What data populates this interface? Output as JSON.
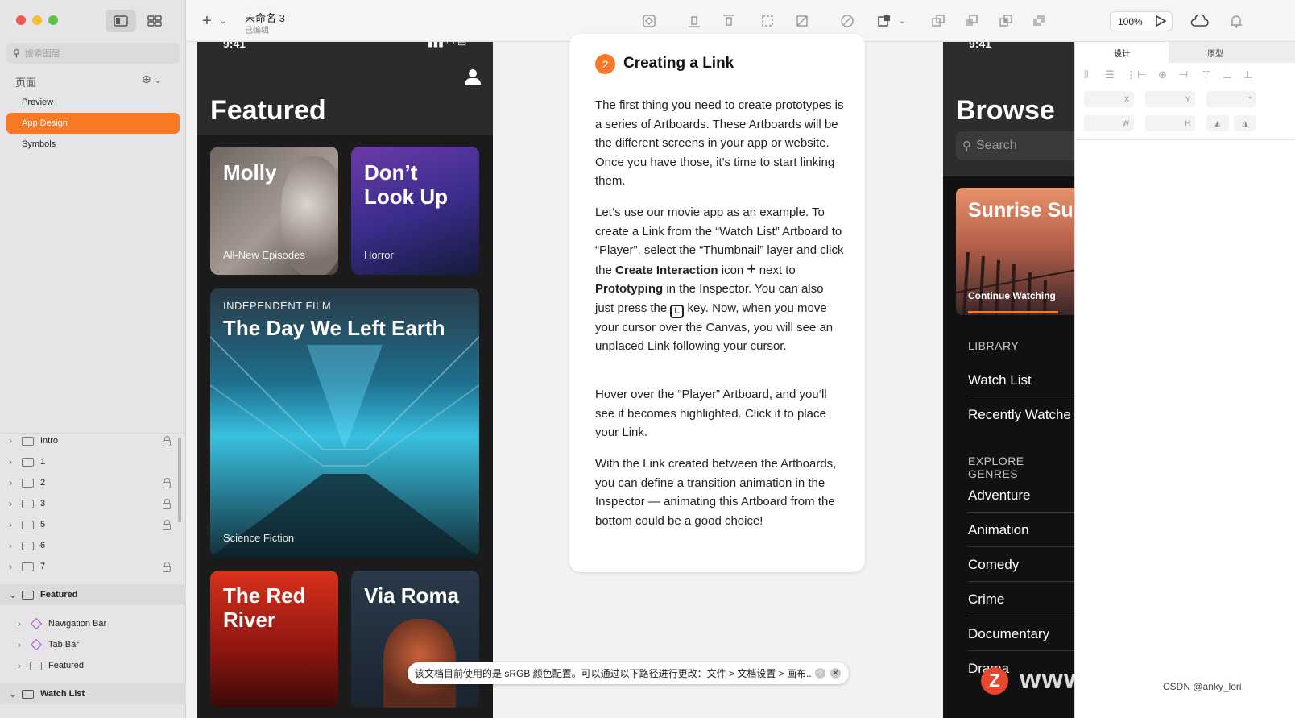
{
  "sidebar": {
    "search_placeholder": "搜索图层",
    "pages_label": "页面",
    "pages": [
      {
        "label": "Preview",
        "active": false
      },
      {
        "label": "App Design",
        "active": true
      },
      {
        "label": "Symbols",
        "active": false
      }
    ],
    "layers": [
      {
        "label": "Intro",
        "locked": true
      },
      {
        "label": "1",
        "locked": false
      },
      {
        "label": "2",
        "locked": true
      },
      {
        "label": "3",
        "locked": true
      },
      {
        "label": "5",
        "locked": true
      },
      {
        "label": "6",
        "locked": false
      },
      {
        "label": "7",
        "locked": true
      }
    ],
    "featured_group": {
      "label": "Featured",
      "children": [
        "Navigation Bar",
        "Tab Bar",
        "Featured"
      ]
    },
    "watch_list_group": "Watch List"
  },
  "toolbar": {
    "doc_title": "未命名 3",
    "doc_status": "已编辑",
    "zoom": "100%"
  },
  "phone1": {
    "time": "9:41",
    "title": "Featured",
    "cards": [
      {
        "title": "Molly",
        "subtitle": "All-New Episodes"
      },
      {
        "title": "Don’t Look Up",
        "subtitle": "Horror"
      },
      {
        "kicker": "INDEPENDENT FILM",
        "title": "The Day We Left Earth",
        "subtitle": "Science Fiction"
      },
      {
        "title": "The Red River"
      },
      {
        "title": "Via Roma"
      }
    ]
  },
  "article": {
    "step": "2",
    "title": "Creating a Link",
    "p1": "The first thing you need to create prototypes is a series of Artboards. These Artboards will be the different screens in your app or website. Once you have those, it's time to start linking them.",
    "p2a": "Let‘s use our movie app as an example. To create a Link from the “Watch List” Artboard to “Player”, select the “Thumbnail” layer and click the ",
    "p2b": "Create Interaction",
    "p2c": " icon ",
    "p2d": " next to ",
    "p2e": "Prototyping",
    "p2f": " in the Inspector. You can also just press the ",
    "p2key": "L",
    "p2g": " key. Now, when you move your cursor over the Canvas, you will see an unplaced Link following your cursor.",
    "p3": "Hover over the “Player” Artboard, and you‘ll see it becomes highlighted. Click it to place your Link.",
    "p4": "With the Link created between the Artboards, you can define a transition animation in the Inspector — animating this Artboard from the bottom could be a good choice!"
  },
  "phone2": {
    "time": "9:41",
    "title": "Browse",
    "search": "Search",
    "hero_title": "Sunrise Sun",
    "hero_sub": "Continue Watching",
    "library_label": "LIBRARY",
    "library": [
      "Watch List",
      "Recently Watche"
    ],
    "genres_label": "EXPLORE GENRES",
    "genres": [
      "Adventure",
      "Animation",
      "Comedy",
      "Crime",
      "Documentary",
      "Drama"
    ]
  },
  "inspector": {
    "tabs": [
      "设计",
      "原型"
    ],
    "fields": {
      "x": "X",
      "y": "Y",
      "w": "W",
      "h": "H",
      "rot": "°"
    }
  },
  "notice": {
    "text": "该文档目前使用的是 sRGB 颜色配置。可以通过以下路径进行更改：文件 > 文档设置 > 画布...",
    "help": "?",
    "close": "✕"
  },
  "watermark": {
    "text": "www.MacZ.com",
    "logo": "Z",
    "credit": "CSDN @anky_lori"
  }
}
